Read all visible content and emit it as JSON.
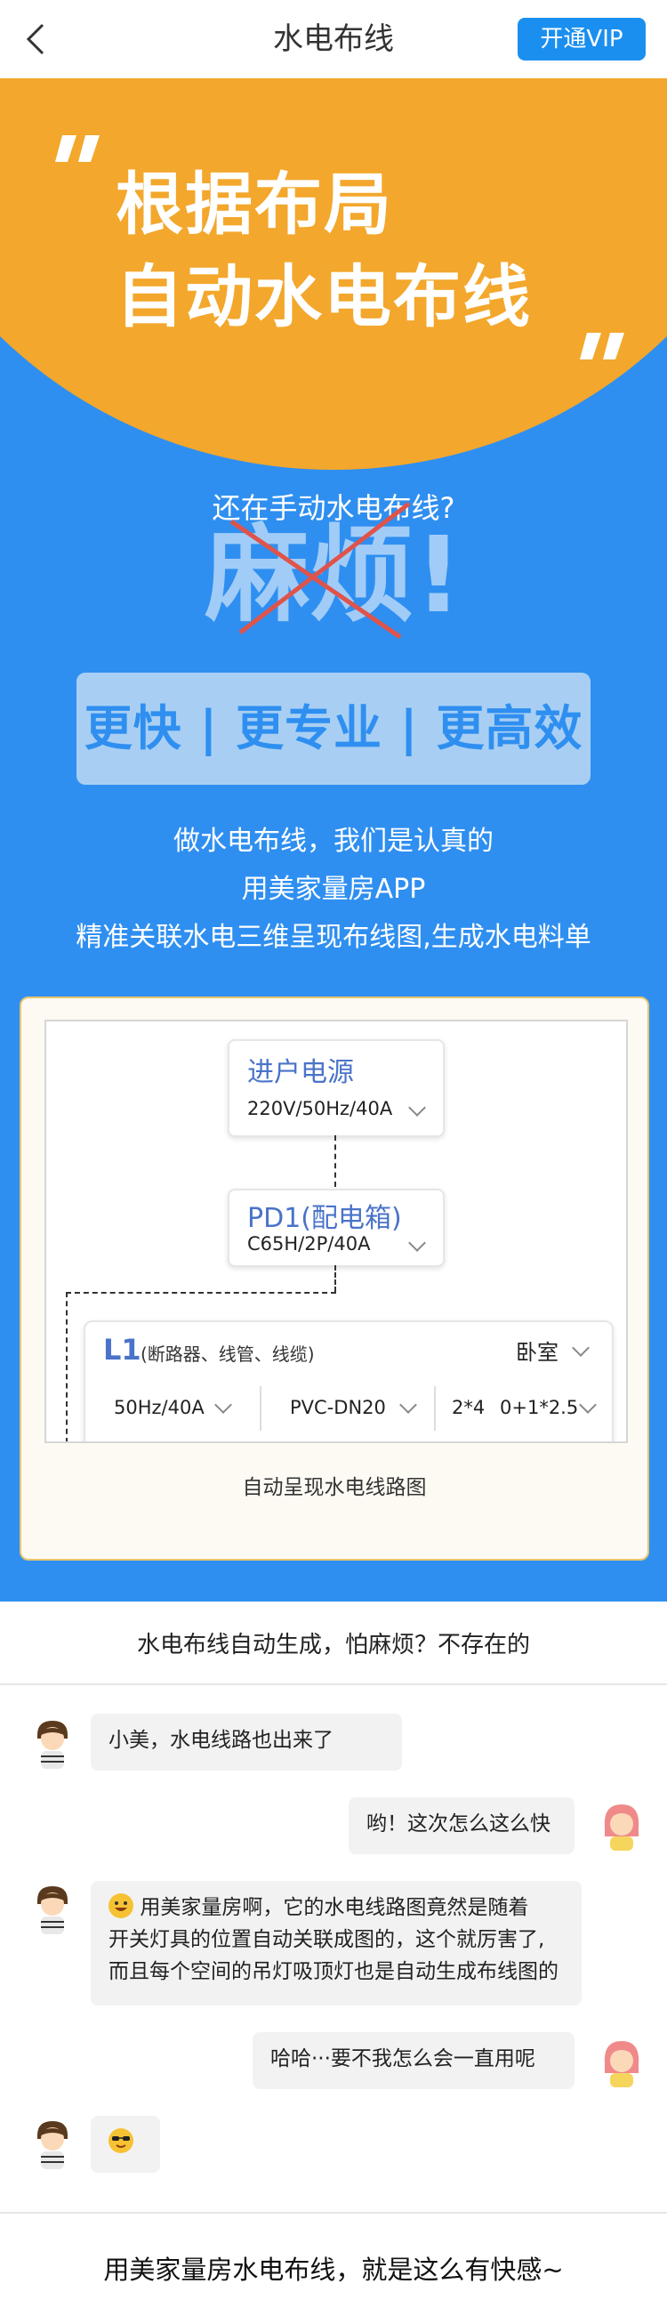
{
  "topbar": {
    "title": "水电布线",
    "vip_label": "开通VIP"
  },
  "hero": {
    "headline_line1": "根据布局",
    "headline_line2": "自动水电布线",
    "question_small": "还在手动水电布线?",
    "question_big": "麻烦!",
    "pill_text": "更快 | 更专业 | 更高效",
    "desc_line1": "做水电布线，我们是认真的",
    "desc_line2": "用美家量房APP",
    "desc_line3": "精准关联水电三维呈现布线图,生成水电料单",
    "colors": {
      "orange": "#f3a72c",
      "blue": "#2f8ff0",
      "pill_bg": "#a8cff3"
    }
  },
  "diagram": {
    "node1": {
      "title": "进户电源",
      "spec": "220V/50Hz/40A"
    },
    "node2": {
      "title": "PD1(配电箱)",
      "spec": "C65H/2P/40A"
    },
    "l1": {
      "title": "L1",
      "subtitle": "(断路器、线管、线缆)",
      "room": "卧室",
      "breaker": "50Hz/40A",
      "pipe": "PVC-DN20",
      "cable_count": "2*4",
      "cable_spec": "0+1*2.5"
    },
    "caption": "自动呈现水电线路图"
  },
  "chat": {
    "header": "水电布线自动生成，怕麻烦？不存在的",
    "messages": [
      {
        "side": "left",
        "text": "小美，水电线路也出来了"
      },
      {
        "side": "right",
        "text": "哟！这次怎么这么快"
      },
      {
        "side": "left",
        "line1": "用美家量房啊，它的水电线路图竟然是随着",
        "line2": "开关灯具的位置自动关联成图的，这个就厉害了,",
        "line3": "而且每个空间的吊灯吸顶灯也是自动生成布线图的",
        "emoji": "grin-emoji"
      },
      {
        "side": "right",
        "text": "哈哈···要不我怎么会一直用呢"
      },
      {
        "side": "left",
        "emoji": "sunglasses-emoji"
      }
    ]
  },
  "footer": {
    "text": "用美家量房水电布线，就是这么有快感~"
  }
}
